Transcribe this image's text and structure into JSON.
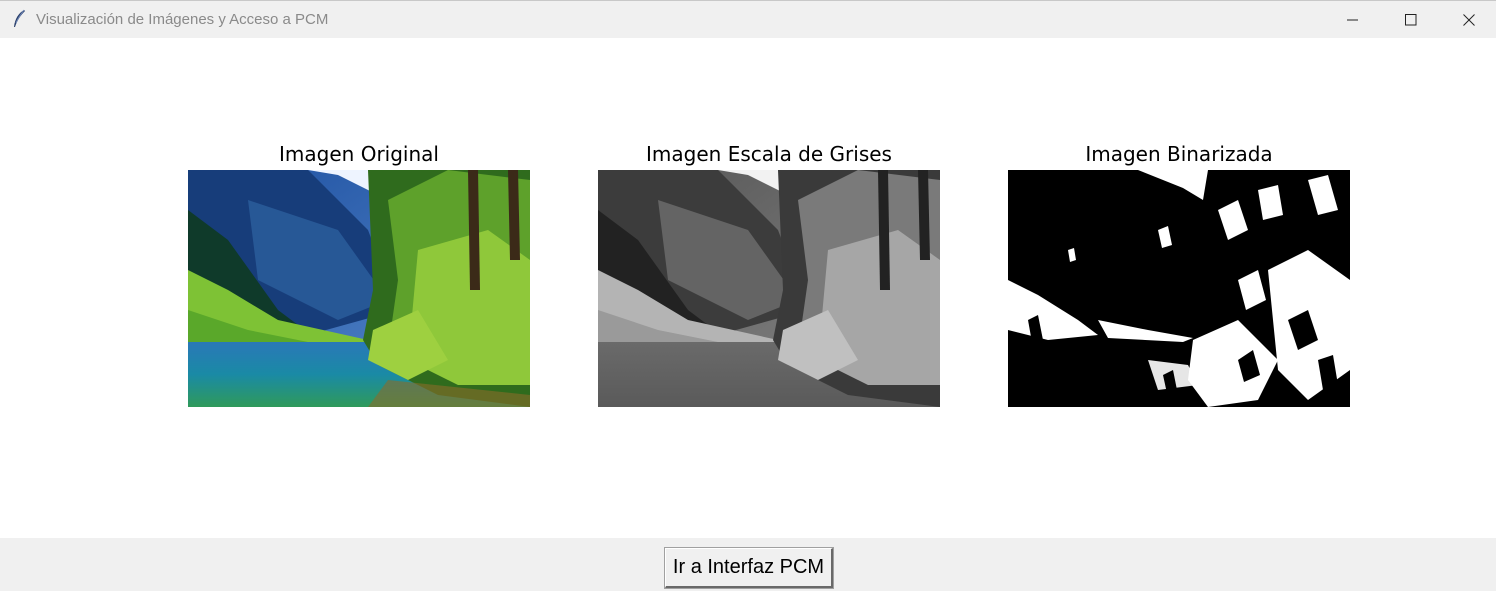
{
  "window": {
    "title": "Visualización de Imágenes y Acceso a PCM",
    "controls": [
      "minimize",
      "maximize",
      "close"
    ]
  },
  "panels": [
    {
      "title": "Imagen Original",
      "mode": "color"
    },
    {
      "title": "Imagen Escala de Grises",
      "mode": "grayscale"
    },
    {
      "title": "Imagen Binarizada",
      "mode": "binary"
    }
  ],
  "footer": {
    "button_label": "Ir a Interfaz PCM"
  },
  "colors": {
    "titlebar_bg": "#f0f0f0",
    "content_bg": "#ffffff",
    "footer_bg": "#f0f0f0"
  }
}
